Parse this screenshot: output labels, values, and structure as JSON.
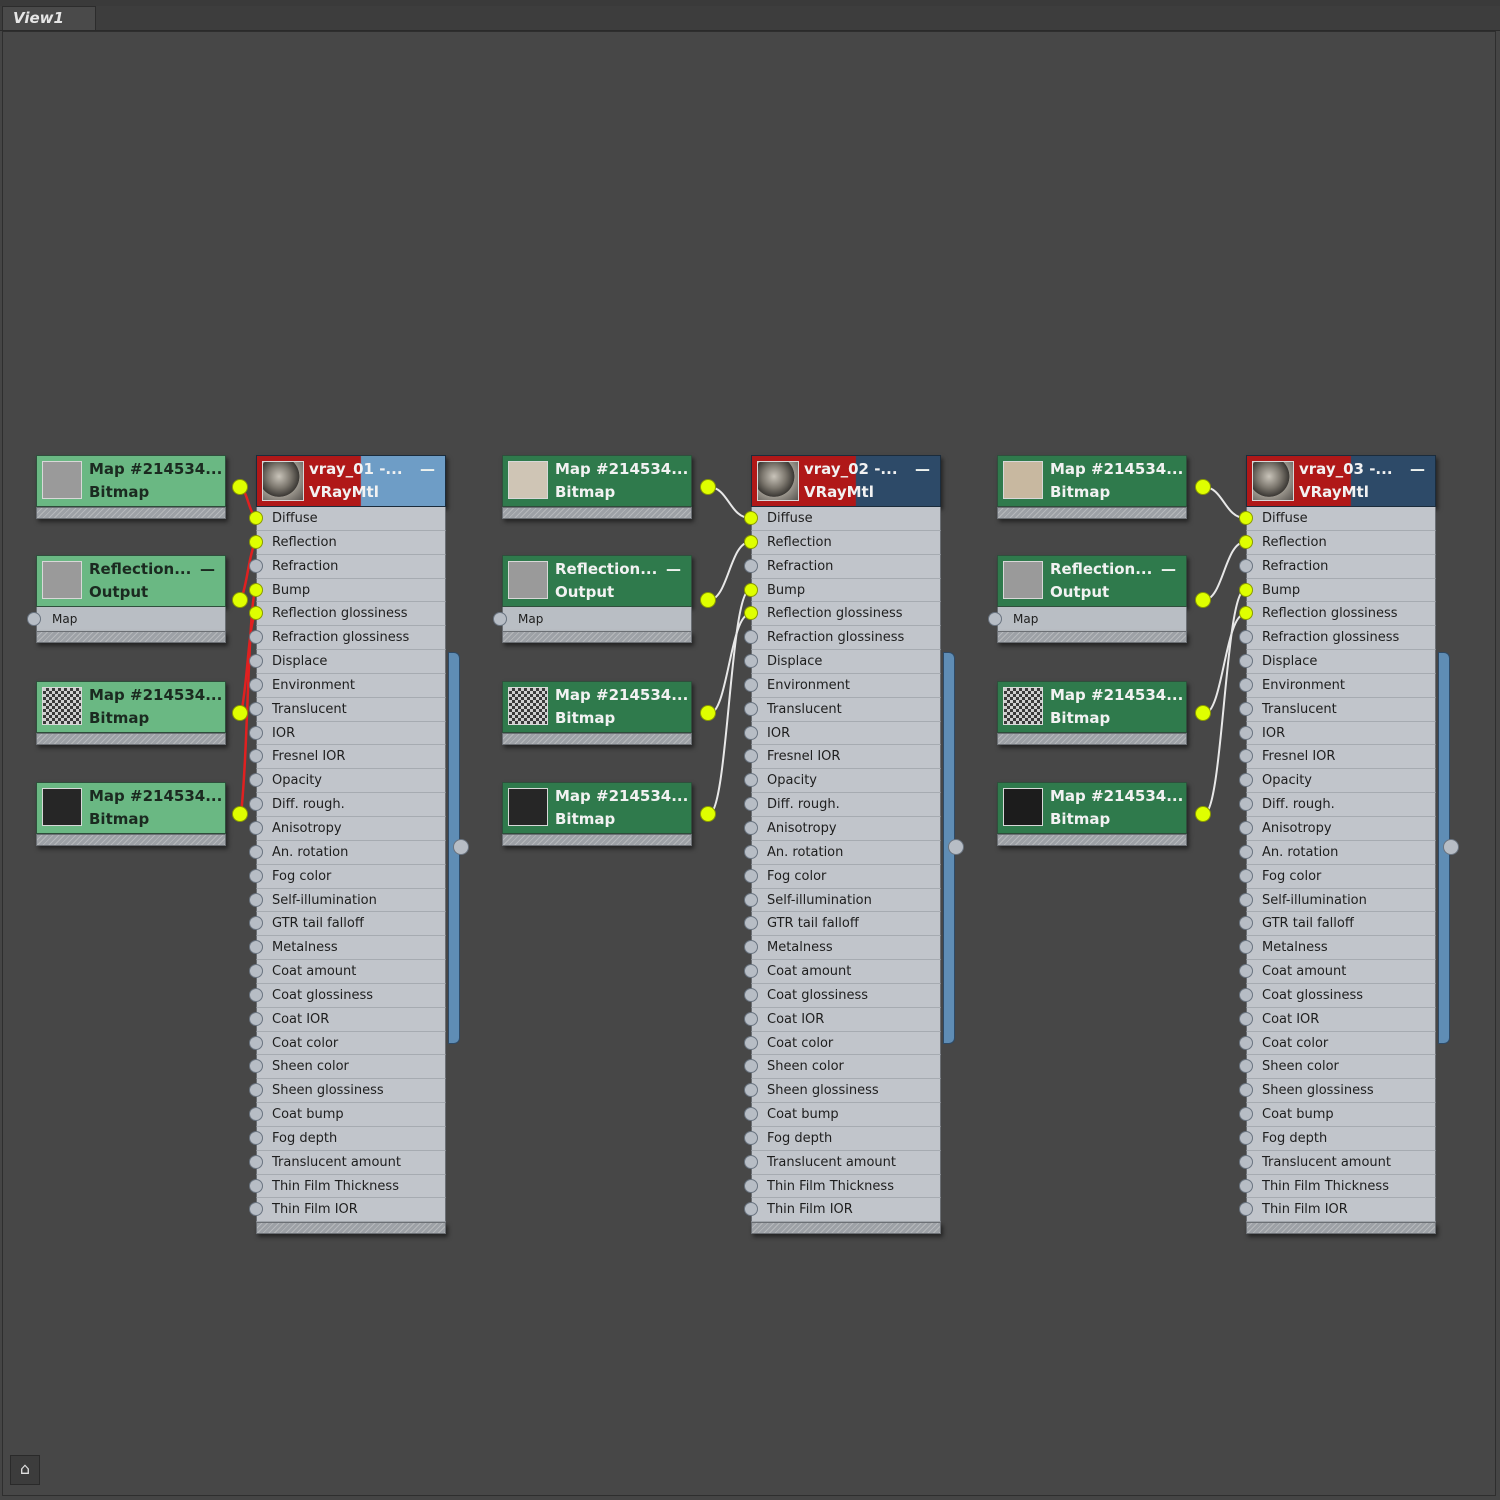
{
  "view_tab": "View1",
  "bitmap_label": "Bitmap",
  "map_title": "Map #214534...",
  "output_title": "Reflection...",
  "output_label": "Output",
  "output_slot": "Map",
  "material_type": "VRayMtl",
  "materials": [
    {
      "name": "vray_01 -..."
    },
    {
      "name": "vray_02 -..."
    },
    {
      "name": "vray_03 -..."
    }
  ],
  "slots": [
    "Diffuse",
    "Reflection",
    "Refraction",
    "Bump",
    "Reflection glossiness",
    "Refraction glossiness",
    "Displace",
    "Environment",
    "Translucent",
    "IOR",
    "Fresnel IOR",
    "Opacity",
    "Diff. rough.",
    "Anisotropy",
    "An. rotation",
    "Fog color",
    "Self-illumination",
    "GTR tail falloff",
    "Metalness",
    "Coat amount",
    "Coat glossiness",
    "Coat IOR",
    "Coat color",
    "Sheen color",
    "Sheen glossiness",
    "Coat bump",
    "Fog depth",
    "Translucent amount",
    "Thin Film Thickness",
    "Thin Film IOR"
  ],
  "connected_slots": [
    "Diffuse",
    "Reflection",
    "Bump",
    "Reflection glossiness"
  ],
  "icons": {
    "minimize": "minimize-icon",
    "pin": "pin-icon"
  },
  "colors": {
    "canvas_bg": "#474747",
    "map_node_light": "#6ab883",
    "map_node_dark": "#2f7a4c",
    "material_header_red": "#b01818",
    "material_header_blue": "#2d4a68",
    "socket_active": "#dfff00",
    "wire": "#e8e8e8",
    "selected_wire": "#e02020"
  }
}
